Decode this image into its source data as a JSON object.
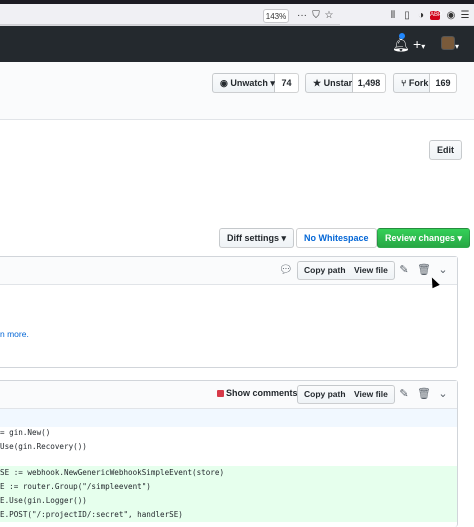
{
  "browser": {
    "zoom": "143%",
    "icons": [
      "overflow-dots-icon",
      "pocket-icon",
      "bookmark-star-icon",
      "library-icon",
      "sidebar-icon",
      "extension-icon",
      "adblock-icon",
      "account-icon",
      "hamburger-menu-icon"
    ],
    "menu_dots": "···",
    "hamburger": "☰"
  },
  "header": {
    "plus": "+",
    "caret": "▾"
  },
  "repo": {
    "watch_label": "Unwatch ▾",
    "watch_count": "74",
    "star_label": "Unstar",
    "star_count": "1,498",
    "fork_label": "Fork",
    "fork_count": "169"
  },
  "pr": {
    "edit_label": "Edit",
    "learn_more": "n more."
  },
  "toolbar": {
    "diff_settings": "Diff settings ▾",
    "no_whitespace": "No Whitespace",
    "review_changes": "Review changes ▾"
  },
  "file1": {
    "copy_path": "Copy path",
    "view_file": "View file"
  },
  "file2": {
    "show_comments": "Show comments",
    "copy_path": "Copy path",
    "view_file": "View file"
  },
  "code_lines": [
    {
      "type": "ctx",
      "text": "= gin.New()"
    },
    {
      "type": "ctx",
      "text": "Use(gin.Recovery())"
    },
    {
      "type": "ctx",
      "text": ""
    },
    {
      "type": "add",
      "text": "SE := webhook.NewGenericWebhookSimpleEvent(store)"
    },
    {
      "type": "add",
      "text": "E := router.Group(\"/simpleevent\")"
    },
    {
      "type": "add",
      "text": "E.Use(gin.Logger())"
    },
    {
      "type": "add",
      "text": "E.POST(\"/:projectID/:secret\", handlerSE)"
    }
  ],
  "colors": {
    "header_bg": "#24292e",
    "link": "#0366d6",
    "green_button": "#28a745",
    "addition_bg": "#e6ffed",
    "hunk_bg": "#f1f8ff"
  }
}
